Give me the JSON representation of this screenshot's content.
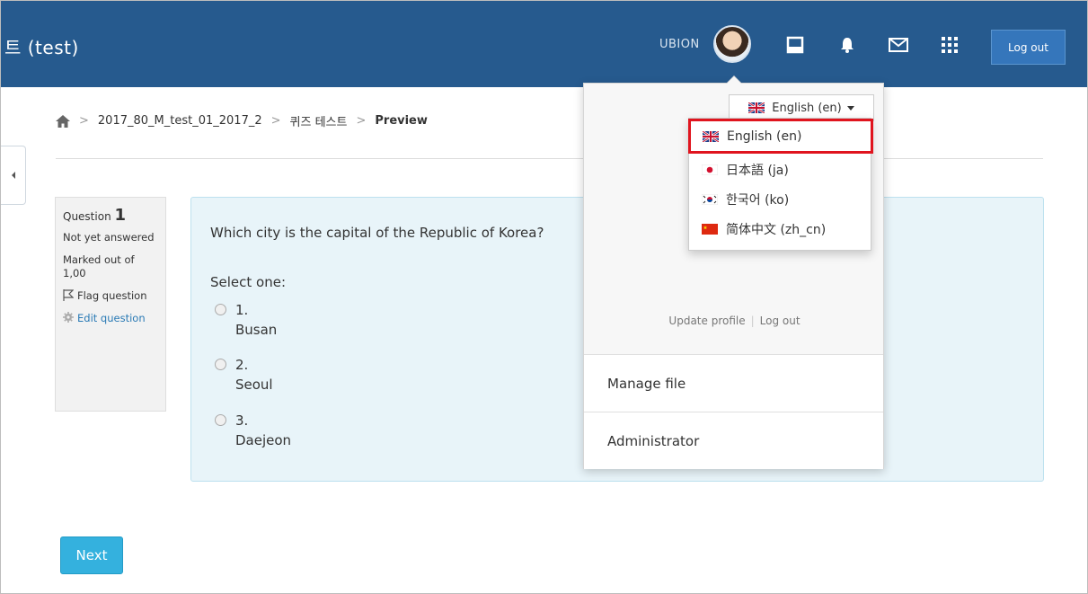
{
  "header": {
    "site_title": "트 (test)",
    "username": "UBION",
    "logout_label": "Log out"
  },
  "breadcrumb": {
    "items": [
      "2017_80_M_test_01_2017_2",
      "퀴즈 테스트",
      "Preview"
    ]
  },
  "question_info": {
    "question_label": "Question",
    "question_number": "1",
    "state": "Not yet answered",
    "grade": "Marked out of 1,00",
    "flag_label": "Flag question",
    "edit_label": "Edit question"
  },
  "question": {
    "text": "Which city is the capital of the Republic of Korea?",
    "prompt": "Select one:",
    "answers": [
      {
        "number": "1.",
        "label": "Busan"
      },
      {
        "number": "2.",
        "label": "Seoul"
      },
      {
        "number": "3.",
        "label": "Daejeon"
      }
    ]
  },
  "next_button_label": "Next",
  "user_menu": {
    "language_current": "English (en)",
    "languages": [
      {
        "label": "English (en)",
        "flag": "uk-flag-icon"
      },
      {
        "label": "日本語 (ja)",
        "flag": "japan-flag-icon"
      },
      {
        "label": "한국어 (ko)",
        "flag": "korea-flag-icon"
      },
      {
        "label": "简体中文 (zh_cn)",
        "flag": "china-flag-icon"
      }
    ],
    "update_profile": "Update profile",
    "logout": "Log out",
    "manage_file": "Manage file",
    "administrator": "Administrator"
  },
  "colors": {
    "navbar": "#265a8e",
    "logout_button": "#3576bb",
    "next_button": "#34b1de",
    "question_bg": "#e8f4f9",
    "highlight_border": "#e0141e"
  }
}
